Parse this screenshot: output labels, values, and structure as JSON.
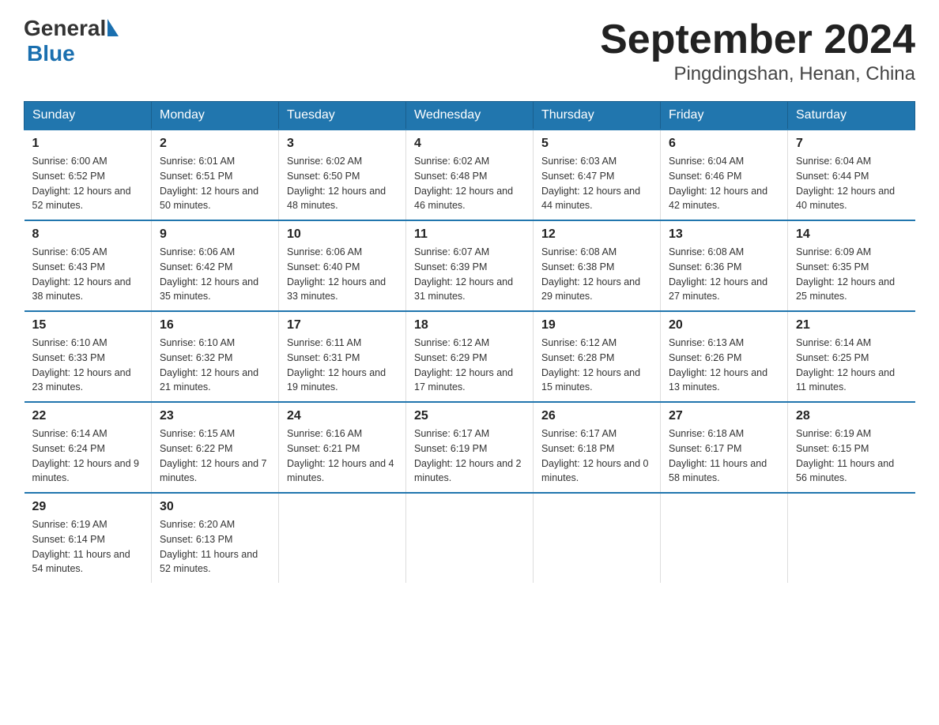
{
  "logo": {
    "text_general": "General",
    "text_blue": "Blue",
    "tagline": "GeneralBlue"
  },
  "title": "September 2024",
  "subtitle": "Pingdingshan, Henan, China",
  "weekdays": [
    "Sunday",
    "Monday",
    "Tuesday",
    "Wednesday",
    "Thursday",
    "Friday",
    "Saturday"
  ],
  "weeks": [
    [
      {
        "day": "1",
        "sunrise": "6:00 AM",
        "sunset": "6:52 PM",
        "daylight": "12 hours and 52 minutes."
      },
      {
        "day": "2",
        "sunrise": "6:01 AM",
        "sunset": "6:51 PM",
        "daylight": "12 hours and 50 minutes."
      },
      {
        "day": "3",
        "sunrise": "6:02 AM",
        "sunset": "6:50 PM",
        "daylight": "12 hours and 48 minutes."
      },
      {
        "day": "4",
        "sunrise": "6:02 AM",
        "sunset": "6:48 PM",
        "daylight": "12 hours and 46 minutes."
      },
      {
        "day": "5",
        "sunrise": "6:03 AM",
        "sunset": "6:47 PM",
        "daylight": "12 hours and 44 minutes."
      },
      {
        "day": "6",
        "sunrise": "6:04 AM",
        "sunset": "6:46 PM",
        "daylight": "12 hours and 42 minutes."
      },
      {
        "day": "7",
        "sunrise": "6:04 AM",
        "sunset": "6:44 PM",
        "daylight": "12 hours and 40 minutes."
      }
    ],
    [
      {
        "day": "8",
        "sunrise": "6:05 AM",
        "sunset": "6:43 PM",
        "daylight": "12 hours and 38 minutes."
      },
      {
        "day": "9",
        "sunrise": "6:06 AM",
        "sunset": "6:42 PM",
        "daylight": "12 hours and 35 minutes."
      },
      {
        "day": "10",
        "sunrise": "6:06 AM",
        "sunset": "6:40 PM",
        "daylight": "12 hours and 33 minutes."
      },
      {
        "day": "11",
        "sunrise": "6:07 AM",
        "sunset": "6:39 PM",
        "daylight": "12 hours and 31 minutes."
      },
      {
        "day": "12",
        "sunrise": "6:08 AM",
        "sunset": "6:38 PM",
        "daylight": "12 hours and 29 minutes."
      },
      {
        "day": "13",
        "sunrise": "6:08 AM",
        "sunset": "6:36 PM",
        "daylight": "12 hours and 27 minutes."
      },
      {
        "day": "14",
        "sunrise": "6:09 AM",
        "sunset": "6:35 PM",
        "daylight": "12 hours and 25 minutes."
      }
    ],
    [
      {
        "day": "15",
        "sunrise": "6:10 AM",
        "sunset": "6:33 PM",
        "daylight": "12 hours and 23 minutes."
      },
      {
        "day": "16",
        "sunrise": "6:10 AM",
        "sunset": "6:32 PM",
        "daylight": "12 hours and 21 minutes."
      },
      {
        "day": "17",
        "sunrise": "6:11 AM",
        "sunset": "6:31 PM",
        "daylight": "12 hours and 19 minutes."
      },
      {
        "day": "18",
        "sunrise": "6:12 AM",
        "sunset": "6:29 PM",
        "daylight": "12 hours and 17 minutes."
      },
      {
        "day": "19",
        "sunrise": "6:12 AM",
        "sunset": "6:28 PM",
        "daylight": "12 hours and 15 minutes."
      },
      {
        "day": "20",
        "sunrise": "6:13 AM",
        "sunset": "6:26 PM",
        "daylight": "12 hours and 13 minutes."
      },
      {
        "day": "21",
        "sunrise": "6:14 AM",
        "sunset": "6:25 PM",
        "daylight": "12 hours and 11 minutes."
      }
    ],
    [
      {
        "day": "22",
        "sunrise": "6:14 AM",
        "sunset": "6:24 PM",
        "daylight": "12 hours and 9 minutes."
      },
      {
        "day": "23",
        "sunrise": "6:15 AM",
        "sunset": "6:22 PM",
        "daylight": "12 hours and 7 minutes."
      },
      {
        "day": "24",
        "sunrise": "6:16 AM",
        "sunset": "6:21 PM",
        "daylight": "12 hours and 4 minutes."
      },
      {
        "day": "25",
        "sunrise": "6:17 AM",
        "sunset": "6:19 PM",
        "daylight": "12 hours and 2 minutes."
      },
      {
        "day": "26",
        "sunrise": "6:17 AM",
        "sunset": "6:18 PM",
        "daylight": "12 hours and 0 minutes."
      },
      {
        "day": "27",
        "sunrise": "6:18 AM",
        "sunset": "6:17 PM",
        "daylight": "11 hours and 58 minutes."
      },
      {
        "day": "28",
        "sunrise": "6:19 AM",
        "sunset": "6:15 PM",
        "daylight": "11 hours and 56 minutes."
      }
    ],
    [
      {
        "day": "29",
        "sunrise": "6:19 AM",
        "sunset": "6:14 PM",
        "daylight": "11 hours and 54 minutes."
      },
      {
        "day": "30",
        "sunrise": "6:20 AM",
        "sunset": "6:13 PM",
        "daylight": "11 hours and 52 minutes."
      },
      null,
      null,
      null,
      null,
      null
    ]
  ]
}
